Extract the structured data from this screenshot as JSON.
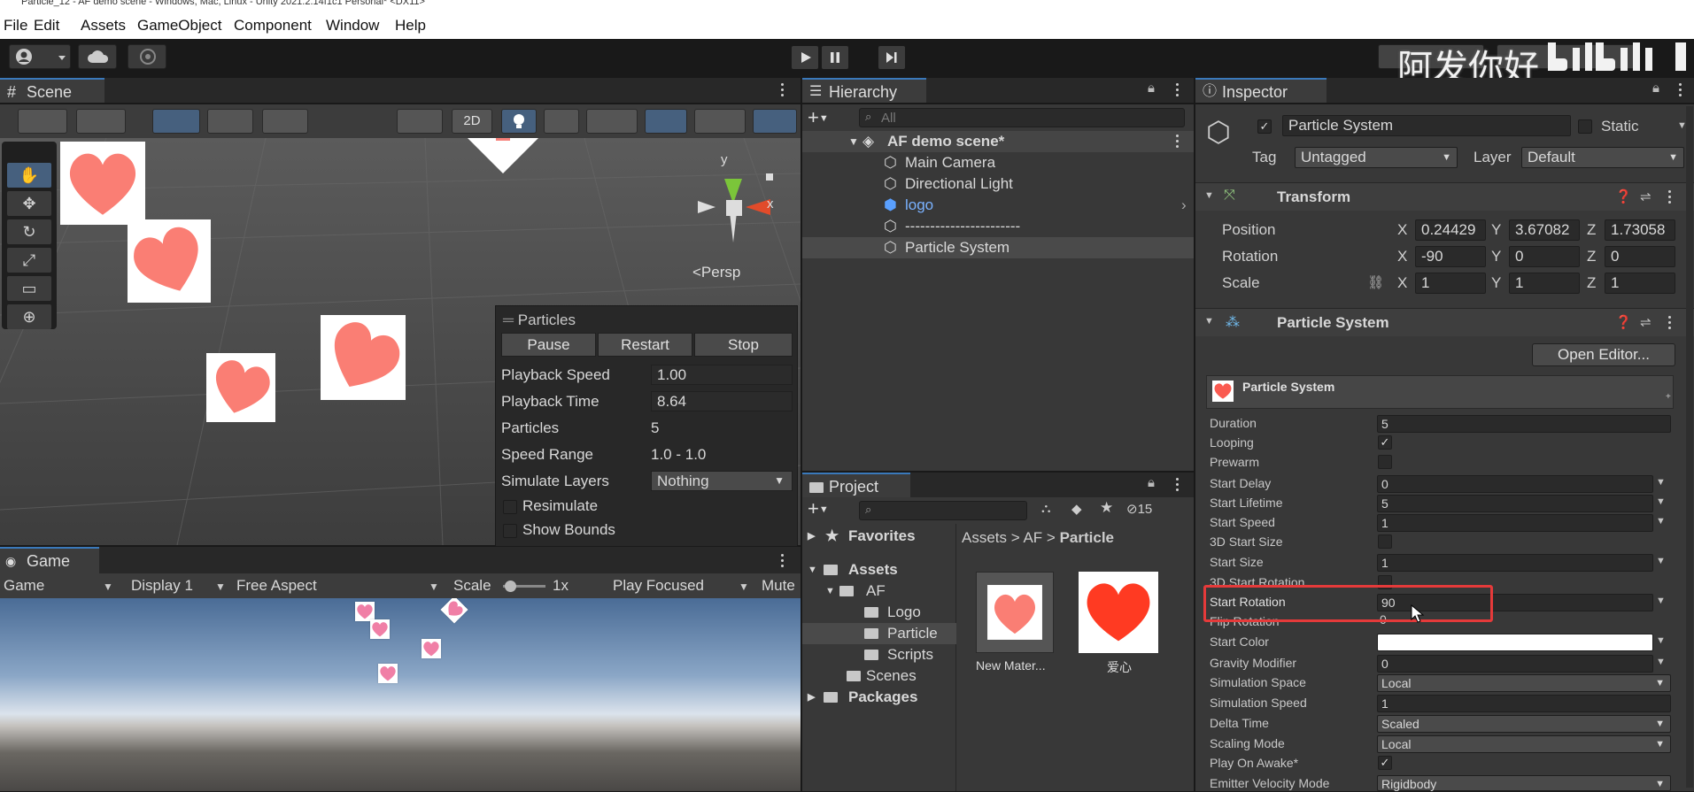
{
  "window": {
    "title": "Particle_12 - AF demo scene - Windows, Mac, Linux - Unity 2021.2.14f1c1 Personal* <DX11>"
  },
  "menu": [
    "File",
    "Edit",
    "Assets",
    "GameObject",
    "Component",
    "Window",
    "Help"
  ],
  "watermark": "阿发你好",
  "scene": {
    "tab": "Scene",
    "btn2d": "2D",
    "persp": "<Persp",
    "gizmo_y": "y",
    "gizmo_x": "x"
  },
  "particles": {
    "title": "Particles",
    "buttons": [
      "Pause",
      "Restart",
      "Stop"
    ],
    "rows": [
      {
        "label": "Playback Speed",
        "value": "1.00"
      },
      {
        "label": "Playback Time",
        "value": "8.64"
      },
      {
        "label": "Particles",
        "value": "5"
      },
      {
        "label": "Speed Range",
        "value": "1.0 - 1.0"
      },
      {
        "label": "Simulate Layers",
        "value": "Nothing"
      }
    ],
    "resimulate": "Resimulate",
    "show_bounds": "Show Bounds"
  },
  "game": {
    "tab": "Game",
    "view": "Game",
    "display": "Display 1",
    "aspect": "Free Aspect",
    "scale_label": "Scale",
    "scale_value": "1x",
    "play_mode": "Play Focused",
    "mute": "Mute"
  },
  "hierarchy": {
    "tab": "Hierarchy",
    "search_placeholder": "All",
    "scene": "AF demo scene*",
    "items": [
      "Main Camera",
      "Directional Light",
      "logo",
      "-----------------------",
      "Particle System"
    ]
  },
  "project": {
    "tab": "Project",
    "hidden_count": "15",
    "tree": [
      "Favorites",
      "Assets",
      "AF",
      "Logo",
      "Particle",
      "Scripts",
      "Scenes",
      "Packages"
    ],
    "breadcrumb": [
      "Assets",
      "AF",
      "Particle"
    ],
    "assets": [
      "New Mater...",
      "爱心"
    ]
  },
  "inspector": {
    "tab": "Inspector",
    "object_name": "Particle System",
    "static_label": "Static",
    "tag_label": "Tag",
    "tag": "Untagged",
    "layer_label": "Layer",
    "layer": "Default",
    "transform": {
      "title": "Transform",
      "position": {
        "label": "Position",
        "x": "0.24429",
        "y": "3.67082",
        "z": "1.73058"
      },
      "rotation": {
        "label": "Rotation",
        "x": "-90",
        "y": "0",
        "z": "0"
      },
      "scale": {
        "label": "Scale",
        "x": "1",
        "y": "1",
        "z": "1"
      }
    },
    "ps_component": "Particle System",
    "open_editor": "Open Editor...",
    "module_title": "Particle System",
    "props": [
      {
        "label": "Duration",
        "value": "5"
      },
      {
        "label": "Looping",
        "value": "✓"
      },
      {
        "label": "Prewarm",
        "value": ""
      },
      {
        "label": "Start Delay",
        "value": "0"
      },
      {
        "label": "Start Lifetime",
        "value": "5"
      },
      {
        "label": "Start Speed",
        "value": "1"
      },
      {
        "label": "3D Start Size",
        "value": ""
      },
      {
        "label": "Start Size",
        "value": "1"
      },
      {
        "label": "3D Start Rotation",
        "value": ""
      },
      {
        "label": "Start Rotation",
        "value": "90"
      },
      {
        "label": "Flip Rotation",
        "value": "0"
      },
      {
        "label": "Start Color",
        "value": ""
      },
      {
        "label": "Gravity Modifier",
        "value": "0"
      },
      {
        "label": "Simulation Space",
        "value": "Local"
      },
      {
        "label": "Simulation Speed",
        "value": "1"
      },
      {
        "label": "Delta Time",
        "value": "Scaled"
      },
      {
        "label": "Scaling Mode",
        "value": "Local"
      },
      {
        "label": "Play On Awake*",
        "value": "✓"
      },
      {
        "label": "Emitter Velocity Mode",
        "value": "Rigidbody"
      }
    ]
  },
  "colors": {
    "accent": "#3a79bb",
    "highlight": "#e53a3a",
    "heart": "#fa7e74",
    "heart_red": "#ff3a22"
  }
}
